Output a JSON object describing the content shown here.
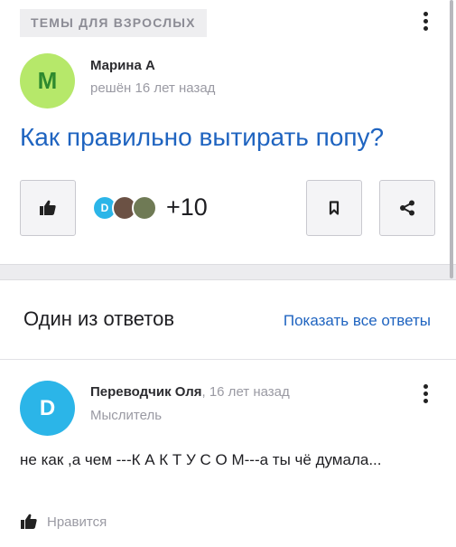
{
  "question": {
    "tag": "ТЕМЫ ДЛЯ ВЗРОСЛЫХ",
    "author_initial": "М",
    "author": "Марина А",
    "status": "решён 16 лет назад",
    "title": "Как правильно вытирать попу?",
    "likers_extra": "+10",
    "avatar_color": "#b6e86a",
    "avatar_text_color": "#2e8a2e"
  },
  "answers_section": {
    "heading": "Один из ответов",
    "show_all": "Показать все ответы"
  },
  "answer": {
    "author_initial": "D",
    "author": "Переводчик Оля",
    "time": ", 16 лет назад",
    "rank": "Мыслитель",
    "text": "не как ,а чем ---К А К Т У С О М---а ты чё думала...",
    "like_label": "Нравится",
    "avatar_color": "#2bb5e8"
  }
}
